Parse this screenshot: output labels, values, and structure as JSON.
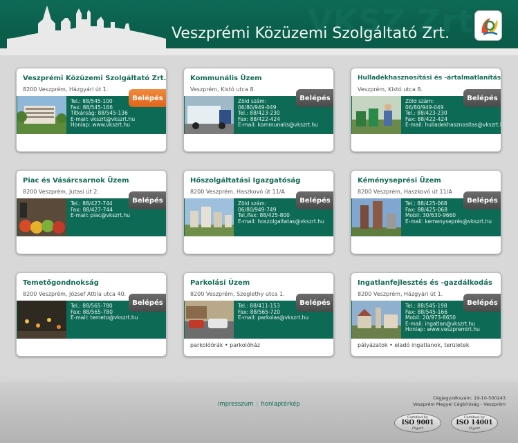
{
  "header": {
    "title": "Veszprémi Közüzemi Szolgáltató Zrt.",
    "watermark": "VKSZ Zrt."
  },
  "login_label": "Belépés",
  "cards": [
    {
      "title": "Veszprémi Közüzemi Szolgáltató Zrt.",
      "address": "8200 Veszprém, Házgyári út 1.",
      "lines": [
        "Tel.: 88/545-100",
        "Fax: 88/545-166",
        "Titkárság: 88/545-136",
        "E-mail: vkszrt@vkszrt.hu",
        "Honlap: www.vkszrt.hu"
      ],
      "tags": "",
      "button_active": true
    },
    {
      "title": "Kommunális Üzem",
      "address": "Veszprém, Kistó utca 8.",
      "lines": [
        "Zöld szám:",
        "06/80/949-049",
        "Tel.: 88/423-230",
        "Fax: 88/422-424",
        "E-mail: kommunalis@vkszrt.hu"
      ],
      "tags": "",
      "button_active": false
    },
    {
      "title": "Hulladékhasznosítási és -ártalmatlanítási Üzem",
      "address": "Veszprém, Kistó utca 8.",
      "lines": [
        "Zöld szám:",
        "06/80/949-049",
        "Tel.: 88/423-230",
        "Fax: 88/422-424",
        "E-mail: hulladekhasznositas@vkszrt.hu"
      ],
      "tags": "",
      "button_active": false
    },
    {
      "title": "Piac és Vásárcsarnok Üzem",
      "address": "8200 Veszprém, Jutasi út 2.",
      "lines": [
        "Tel.: 88/427-744",
        "Fax: 88/427-744",
        "E-mail: piac@vkszrt.hu"
      ],
      "tags": "",
      "button_active": false
    },
    {
      "title": "Hőszolgáltatási Igazgatóság",
      "address": "8200 Veszprém, Haszkovó út 11/A",
      "lines": [
        "Zöld szám:",
        "06/80/949-749",
        "Tel./fax: 88/425-800",
        "E-mail: hoszolgaltatas@vkszrt.hu"
      ],
      "tags": "",
      "button_active": false
    },
    {
      "title": "Kéményseprési Üzem",
      "address": "8200 Veszprém, Haszkovó út 11/A",
      "lines": [
        "Tel.: 88/425-068",
        "Fax: 88/425-068",
        "Mobil: 30/630-9660",
        "E-mail: kemenyseprés@vkszrt.hu"
      ],
      "tags": "",
      "button_active": false
    },
    {
      "title": "Temetőgondnokság",
      "address": "8200 Veszprém, József Attila utca 40.",
      "lines": [
        "Tel.: 88/565-780",
        "Fax: 88/565-780",
        "E-mail: temeto@vkszrt.hu"
      ],
      "tags": "",
      "button_active": false
    },
    {
      "title": "Parkolási Üzem",
      "address": "8200 Veszprém, Szeglethy utca 1.",
      "lines": [
        "Tel.: 88/411-153",
        "Fax: 88/565-720",
        "E-mail: parkolas@vkszrt.hu"
      ],
      "tags": "parkolóórák • parkolóház",
      "button_active": false
    },
    {
      "title": "Ingatlanfejlesztés és -gazdálkodás",
      "address": "8200 Veszprém, Házgyári út 1.",
      "lines": [
        "Tel.: 88/545-198",
        "Fax: 88/545-166",
        "Mobil: 20/973-8650",
        "E-mail: ingatlan@vkszrt.hu",
        "Honlap: www.veszpremirt.hu"
      ],
      "tags": "pályázatok • eladó ingatlanok, területek",
      "button_active": false
    }
  ],
  "footer": {
    "links": [
      "impresszum",
      "honlaptérkép"
    ],
    "separator": "|",
    "registry": [
      "Cégjegyzékszám: 19-10-500243",
      "Veszprém Megyei Cégbíróság - Veszprém"
    ],
    "iso": [
      {
        "top": "Certified by",
        "code": "ISO 9001",
        "by": "Digart"
      },
      {
        "top": "Certified by",
        "code": "ISO 14001",
        "by": "Digart"
      }
    ]
  },
  "colors": {
    "brand_green": "#0d6b55",
    "active_button": "#e8742a",
    "title_green": "#146a56"
  }
}
